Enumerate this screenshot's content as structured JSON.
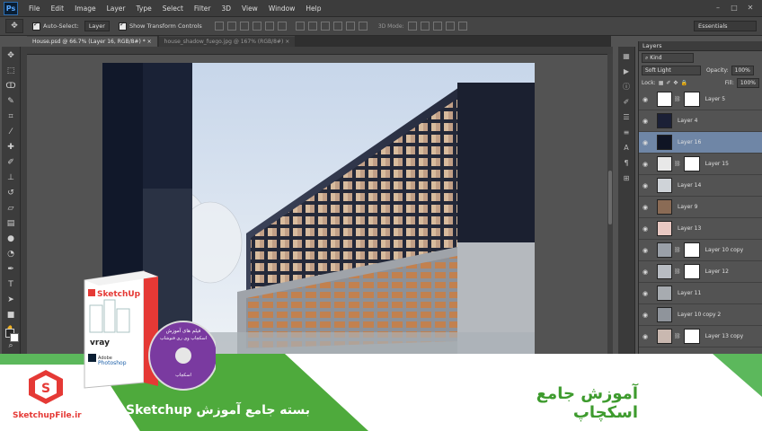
{
  "app": {
    "logo": "Ps",
    "accent": "#2b6cb0"
  },
  "menu": [
    "File",
    "Edit",
    "Image",
    "Layer",
    "Type",
    "Select",
    "Filter",
    "3D",
    "View",
    "Window",
    "Help"
  ],
  "window_controls": [
    "minimize-icon",
    "maximize-icon",
    "close-icon"
  ],
  "options_bar": {
    "auto_select_label": "Auto-Select:",
    "auto_select_value": "Layer",
    "show_transform_label": "Show Transform Controls",
    "mode_3d_label": "3D Mode:",
    "workspace": "Essentials"
  },
  "doc_tabs": [
    {
      "title": "House.psd @ 66.7% (Layer 16, RGB/8#) *",
      "close": "×",
      "active": true
    },
    {
      "title": "house_shadow_fuego.jpg @ 167% (RGB/8#)",
      "close": "×",
      "active": false
    }
  ],
  "tools": [
    "move-icon",
    "marquee-icon",
    "lasso-icon",
    "quick-select-icon",
    "crop-icon",
    "eyedropper-icon",
    "healing-icon",
    "brush-icon",
    "stamp-icon",
    "history-brush-icon",
    "eraser-icon",
    "gradient-icon",
    "blur-icon",
    "dodge-icon",
    "pen-icon",
    "type-icon",
    "path-select-icon",
    "shape-icon",
    "hand-icon",
    "zoom-icon"
  ],
  "layers_panel": {
    "title": "Layers",
    "filter_kind": "Kind",
    "blend_mode": "Soft Light",
    "opacity_label": "Opacity:",
    "opacity_value": "100%",
    "lock_label": "Lock:",
    "fill_label": "Fill:",
    "fill_value": "100%",
    "layers": [
      {
        "name": "Layer 5",
        "thumb": "#ffffff",
        "mask": true,
        "selected": false
      },
      {
        "name": "Layer 4",
        "thumb": "#1b2036",
        "mask": false,
        "selected": false
      },
      {
        "name": "Layer 16",
        "thumb": "#0f1424",
        "mask": false,
        "selected": true
      },
      {
        "name": "Layer 15",
        "thumb": "#e8e8e8",
        "mask": true,
        "selected": false
      },
      {
        "name": "Layer 14",
        "thumb": "#cfd3d8",
        "mask": false,
        "selected": false
      },
      {
        "name": "Layer 9",
        "thumb": "#8a6b55",
        "mask": false,
        "selected": false
      },
      {
        "name": "Layer 13",
        "thumb": "#e9c9c3",
        "mask": false,
        "selected": false
      },
      {
        "name": "Layer 10 copy",
        "thumb": "#9aa0a8",
        "mask": true,
        "selected": false
      },
      {
        "name": "Layer 12",
        "thumb": "#b8bcc2",
        "mask": true,
        "selected": false
      },
      {
        "name": "Layer 11",
        "thumb": "#a7abb0",
        "mask": false,
        "selected": false
      },
      {
        "name": "Layer 10 copy 2",
        "thumb": "#8f949b",
        "mask": false,
        "selected": false
      },
      {
        "name": "Layer 13 copy",
        "thumb": "#c9b8b0",
        "mask": true,
        "selected": false
      }
    ]
  },
  "banner": {
    "brand": "SketchupFile.ir",
    "left_title": "بسته جامع آموزش Sketchup",
    "right_title": "آموزش جامع اسکچاپ",
    "green": "#4eaa3c",
    "red": "#e53935"
  },
  "product_box": {
    "title": "SketchUp",
    "plugin": "vray",
    "brand_line": "Adobe",
    "app_line": "Photoshop",
    "disc_text_1": "فیلم های آموزش",
    "disc_text_2": "اسکچاپ وی ری فتوشاپ",
    "disc_text_3": "اسکچاپ"
  }
}
